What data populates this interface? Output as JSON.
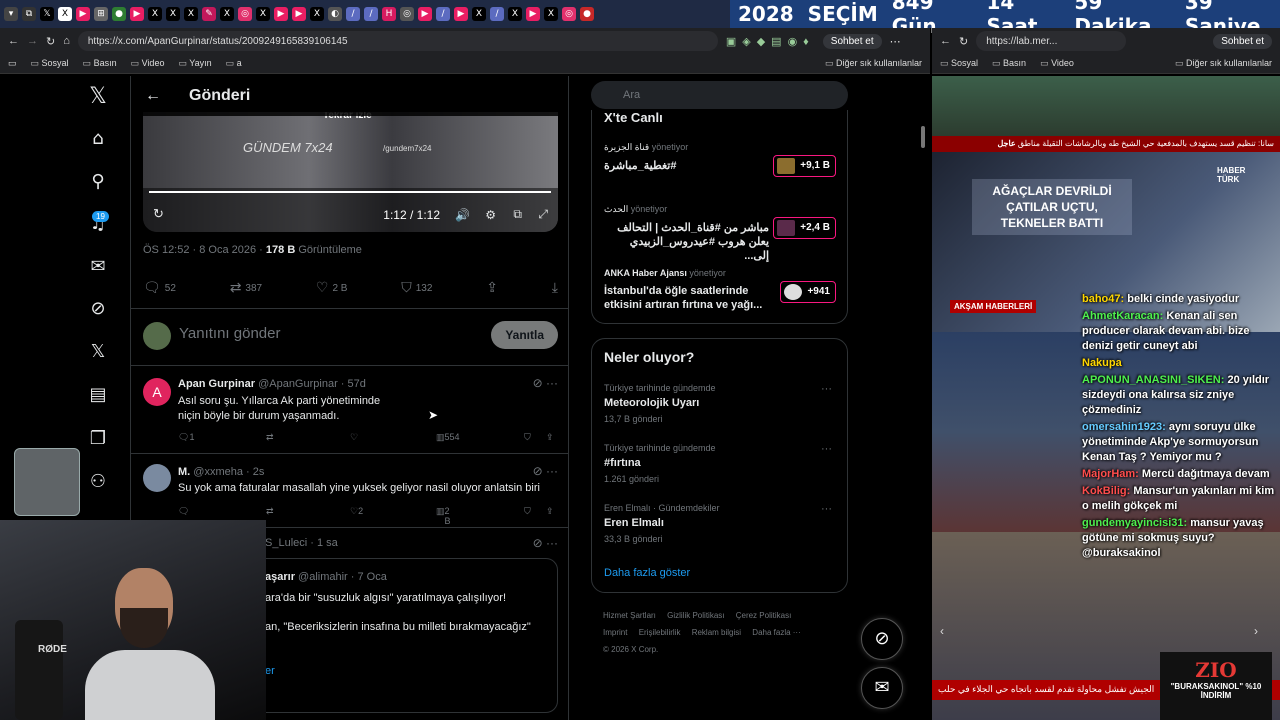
{
  "countdown": {
    "year": "2028",
    "label": "SEÇİM",
    "days": "849 Gün",
    "hours": "14 Saat",
    "minutes": "59 Dakika",
    "seconds": "39 Saniye"
  },
  "browser_left": {
    "url": "https://x.com/ApanGurpinar/status/2009249165839106145",
    "sohbet": "Sohbet et",
    "bookmarks": [
      "Sosyal",
      "Basın",
      "Video",
      "Yayın",
      "a"
    ],
    "bookmarks_other": "Diğer sık kullanılanlar"
  },
  "browser_right": {
    "url": "https://lab.mer...",
    "sohbet": "Sohbet et",
    "bookmarks": [
      "Sosyal",
      "Basın",
      "Video"
    ],
    "bookmarks_other": "Diğer sık kullanılanlar"
  },
  "nav": {
    "notifications_badge": "19",
    "icons": [
      "x-logo-icon",
      "home-icon",
      "search-icon",
      "notifications-icon",
      "messages-icon",
      "grok-icon",
      "x-premium-icon",
      "lists-icon",
      "bookmarks-icon",
      "communities-icon"
    ]
  },
  "post_header": {
    "back": "←",
    "title": "Gönderi"
  },
  "video": {
    "overlay_text": "Tekrar izle",
    "watermark": "GÜNDEM 7x24",
    "handle": "/gundem7x24",
    "time": "1:12 / 1:12"
  },
  "post_meta": {
    "time": "ÖS 12:52 · 8 Oca 2026 · ",
    "views": "178 B",
    "views_label": " Görüntüleme"
  },
  "post_actions": {
    "replies": "52",
    "reposts": "387",
    "likes": "2 B",
    "bookmarks": "132"
  },
  "reply_box": {
    "placeholder": "Yanıtını gönder",
    "button": "Yanıtla"
  },
  "replies": [
    {
      "name": "Apan Gurpinar",
      "handle": "@ApanGurpinar · 57d",
      "avatar_letter": "A",
      "text_line1": "Asıl soru şu. Yıllarca Ak parti yönetiminde",
      "text_line2": " niçin böyle bir durum yaşanmadı.",
      "reply_count": "1",
      "like_count": "",
      "view_count": "554"
    },
    {
      "name": "M.",
      "handle": "@xxmeha · 2s",
      "text": "Su yok ama faturalar masallah yine yuksek geliyor nasil oluyor anlatsin biri",
      "like_count": "2",
      "view_count": "2 B"
    },
    {
      "handle": "S_Luleci · 1 sa",
      "quote_name": "aşarır",
      "quote_handle": "@alimahir · 7 Oca",
      "quote_line1": "ara'da bir \"susuzluk algısı\" yaratılmaya çalışılıyor!",
      "quote_line2": "an, \"Beceriksizlerin insafına bu milleti bırakmayacağız\"",
      "quote_more": "er"
    }
  ],
  "search": {
    "placeholder": "Ara"
  },
  "live": {
    "header": "X'te Canlı",
    "items": [
      {
        "source": "قناة الجزيرة",
        "managing": "yönetiyor",
        "text": "تغطية_مباشرة#",
        "count": "+9,1 B"
      },
      {
        "source": "الحدث",
        "managing": "yönetiyor",
        "text_line1": "مباشر من #قناة_الحدث | التحالف",
        "text_line2": "يعلن هروب #عيدروس_الزبيدي إلى...",
        "count": "+2,4 B"
      },
      {
        "source": "ANKA Haber Ajansı",
        "managing": "yönetiyor",
        "text_line1": "İstanbul'da öğle saatlerinde",
        "text_line2": "etkisini artıran fırtına ve yağı...",
        "count": "+941"
      }
    ]
  },
  "trends": {
    "header": "Neler oluyor?",
    "items": [
      {
        "context": "Türkiye tarihinde gündemde",
        "name": "Meteorolojik Uyarı",
        "count": "13,7 B gönderi"
      },
      {
        "context": "Türkiye tarihinde gündemde",
        "name": "#fırtına",
        "count": "1.261 gönderi"
      },
      {
        "context": "Eren Elmalı · Gündemdekiler",
        "name": "Eren Elmalı",
        "count": "33,3 B gönderi"
      }
    ],
    "show_more": "Daha fazla göster"
  },
  "footer": {
    "links": [
      "Hizmet Şartları",
      "Gizlilik Politikası",
      "Çerez Politikası",
      "Imprint",
      "Erişilebilirlik",
      "Reklam bilgisi",
      "Daha fazla ···"
    ],
    "copyright": "© 2026 X Corp."
  },
  "stream": {
    "ticker_top": "سانا: تنظيم قسد يستهدف بالمدفعية حي الشيخ طه وبالرشاشات الثقيلة مناطق",
    "ticker_label": "عاجل",
    "channel": "HABER TÜRK",
    "headline": "AĞAÇLAR DEVRİLDİ ÇATILAR UÇTU, TEKNELER BATTI",
    "program": "AKŞAM HABERLERİ",
    "bottom_ticker": "الجيش تفشل محاولة تقدم لقسد باتجاه حي الجلاء في حلب",
    "promo_logo": "ZIO",
    "promo_text": "\"BURAKSAKINOL\" %10 İNDİRİM"
  },
  "chat": [
    {
      "user": "baho47:",
      "msg": " belki cinde yasiyodur",
      "color": "y"
    },
    {
      "user": "AhmetKaracan:",
      "msg": " Kenan ali sen producer olarak devam abi. bize denizi getir cuneyt abi",
      "color": "g"
    },
    {
      "user": "Nakupa",
      "msg": "",
      "color": "y"
    },
    {
      "user": "APONUN_ANASINI_SIKEN:",
      "msg": " 20 yıldır sizdeydi ona kalırsa siz zniye çözmediniz",
      "color": "g"
    },
    {
      "user": "omersahin1923:",
      "msg": " aynı soruyu ülke yönetiminde Akp'ye sormuyorsun Kenan Taş ? Yemiyor mu ?",
      "color": "b"
    },
    {
      "user": "MajorHam:",
      "msg": " Mercü dağıtmaya devam",
      "color": "u"
    },
    {
      "user": "KokBilig:",
      "msg": " Mansur'un yakınları mi kim o melih gökçek mi",
      "color": "u"
    },
    {
      "user": "gundemyayincisi31:",
      "msg": " mansur yavaş götüne mi sokmuş suyu? @buraksakinol",
      "color": "g"
    }
  ],
  "webcam": {
    "mic_brand": "RØDE"
  }
}
